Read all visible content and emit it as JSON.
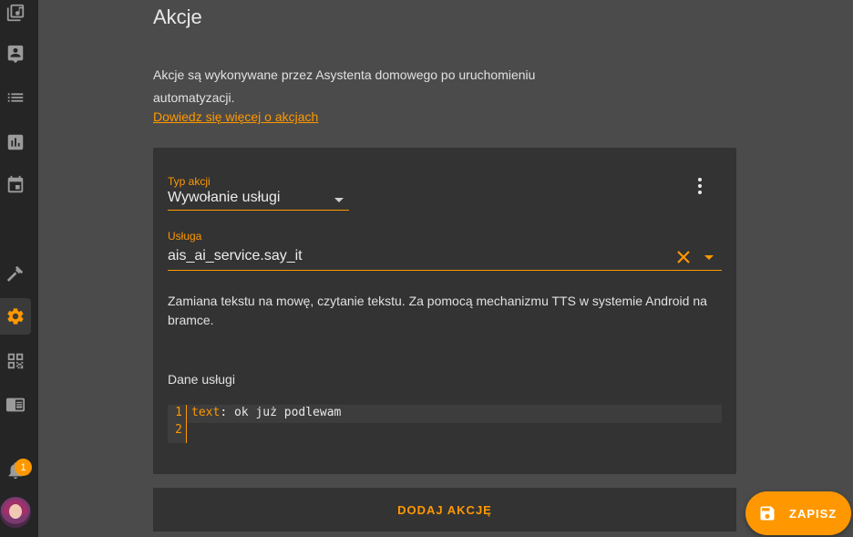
{
  "page": {
    "title": "Akcje"
  },
  "intro": {
    "text": "Akcje są wykonywane przez Asystenta domowego po uruchomieniu automatyzacji.",
    "link": "Dowiedz się więcej o akcjach"
  },
  "sidebar": {
    "items": [
      {
        "name": "media-icon"
      },
      {
        "name": "person-icon"
      },
      {
        "name": "list-icon"
      },
      {
        "name": "chart-icon"
      },
      {
        "name": "calendar-icon"
      },
      {
        "name": "hammer-icon"
      },
      {
        "name": "gear-icon",
        "active": true
      },
      {
        "name": "qr-code-icon"
      },
      {
        "name": "panel-icon"
      }
    ],
    "notifications": {
      "count": "1"
    }
  },
  "action": {
    "type_label": "Typ akcji",
    "type_value": "Wywołanie usługi",
    "service_label": "Usługa",
    "service_value": "ais_ai_service.say_it",
    "description": "Zamiana tekstu na mowę, czytanie tekstu. Za pomocą mechanizmu TTS w systemie Android na bramce.",
    "service_data_label": "Dane usługi",
    "code": {
      "line_numbers": [
        "1",
        "2"
      ],
      "line1_key": "text",
      "line1_rest": ": ok już podlewam"
    }
  },
  "buttons": {
    "add_action": "DODAJ AKCJĘ",
    "save": "ZAPISZ"
  },
  "colors": {
    "accent": "#ff9800",
    "background": "#4b4b4b",
    "card": "#333333",
    "sidebar": "#252525"
  }
}
